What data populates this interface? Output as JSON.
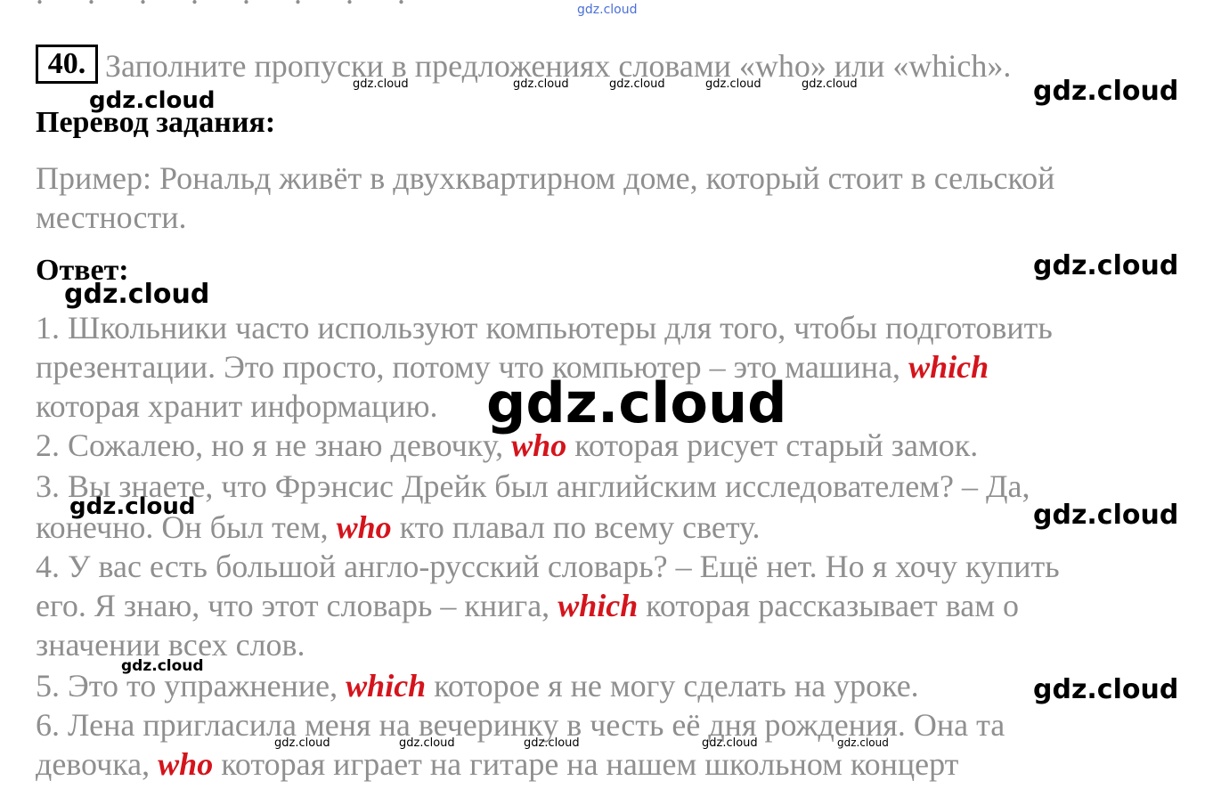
{
  "task": {
    "number": "40.",
    "instruction": "Заполните пропуски в предложениях словами «who» или «which»."
  },
  "translation": {
    "heading": "Перевод задания:",
    "line1": "Пример: Рональд живёт в двухквартирном доме, который стоит в сельской",
    "line2": "местности."
  },
  "answer": {
    "heading": "Ответ:",
    "items": [
      {
        "l1": "1. Школьники часто используют компьютеры для того, чтобы подготовить",
        "l2_pre": "презентации. Это просто, потому что компьютер – это машина, ",
        "word": "which",
        "l3": "которая хранит информацию."
      },
      {
        "pre": "2. Сожалею, но я не знаю девочку, ",
        "word": "who",
        "post": " которая рисует старый замок."
      },
      {
        "l1": "3. Вы знаете, что Фрэнсис Дрейк был английским исследователем? – Да,",
        "l2_pre": "конечно. Он был тем, ",
        "word": "who",
        "l2_post": " кто плавал по всему свету."
      },
      {
        "l1": "4. У вас есть большой англо-русский словарь? – Ещё нет. Но я хочу купить",
        "l2_pre": "его. Я знаю, что этот словарь – книга, ",
        "word": "which",
        "l2_post": " которая рассказывает вам о",
        "l3": "значении всех слов."
      },
      {
        "pre": "5. Это то упражнение, ",
        "word": "which",
        "post": " которое я не могу сделать на уроке."
      },
      {
        "l1": "6. Лена пригласила меня на вечеринку в честь её дня рождения. Она та",
        "l2_pre": "девочка, ",
        "word": "who",
        "l2_post": " которая играет на гитаре  на нашем школьном концерт"
      }
    ]
  },
  "watermark": {
    "text": "gdz.cloud"
  },
  "colors": {
    "body_text": "#8f8f8f",
    "answer_word": "#d4141c",
    "heading": "#000000",
    "watermark_top": "#4a6fd8"
  }
}
